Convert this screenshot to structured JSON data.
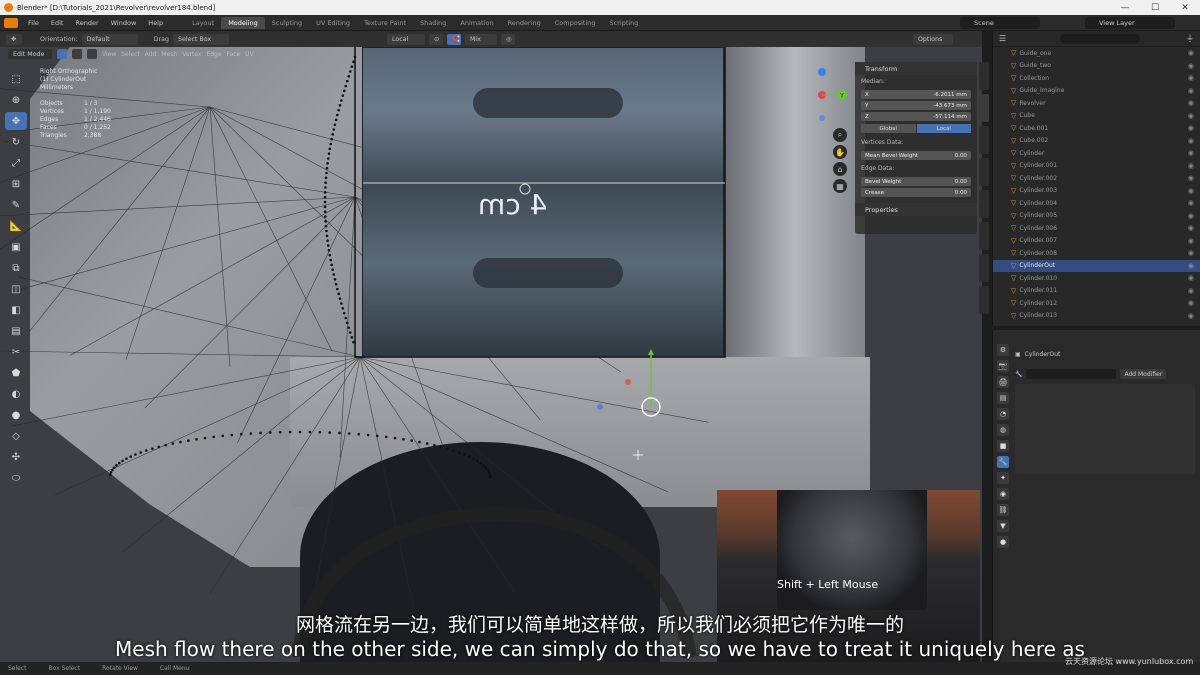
{
  "window": {
    "title": "Blender* [D:\\Tutorials_2021\\Revolver\\revolver184.blend]",
    "controls": [
      "—",
      "☐",
      "✕"
    ]
  },
  "menu": [
    "File",
    "Edit",
    "Render",
    "Window",
    "Help"
  ],
  "workspaces": [
    "Layout",
    "Modeling",
    "Sculpting",
    "UV Editing",
    "Texture Paint",
    "Shading",
    "Animation",
    "Rendering",
    "Compositing",
    "Scripting"
  ],
  "active_workspace": "Modeling",
  "scene": {
    "scene_label": "Scene",
    "view_layer_label": "View Layer"
  },
  "header2": {
    "orientation_label": "Orientation:",
    "orientation_value": "Default",
    "drag_label": "Drag",
    "drag_value": "Select Box",
    "pivot_value": "Local",
    "snap_value": "Mix",
    "options_label": "Options"
  },
  "header3": {
    "mode": "Edit Mode",
    "items": [
      "View",
      "Select",
      "Add",
      "Mesh",
      "Vertex",
      "Edge",
      "Face",
      "UV"
    ]
  },
  "viewport": {
    "view_name": "Right Orthographic",
    "object_name": "(1) CylinderOut",
    "units": "Millimeters",
    "stats": [
      {
        "label": "Objects",
        "value": "1 / 3"
      },
      {
        "label": "Vertices",
        "value": "1 / 1,190"
      },
      {
        "label": "Edges",
        "value": "1 / 2,446"
      },
      {
        "label": "Faces",
        "value": "0 / 1,252"
      },
      {
        "label": "Triangles",
        "value": "2,388"
      }
    ],
    "ref_text": "4 cm",
    "gizmo_axes": {
      "x": "X",
      "y": "Y",
      "z": "Z"
    },
    "colors": {
      "x": "#e8424f",
      "y": "#6bc33a",
      "z": "#3c7ef0"
    }
  },
  "tools": [
    "cursor",
    "move",
    "rotate",
    "scale",
    "transform",
    "annotate",
    "measure",
    "add-cube",
    "extrude",
    "inset",
    "bevel",
    "loop-cut",
    "knife",
    "poly-build",
    "spin",
    "smooth",
    "edge-slide",
    "shrink",
    "shear",
    "rip"
  ],
  "n_panel": {
    "title": "Transform",
    "median_label": "Median:",
    "fields": [
      {
        "axis": "X",
        "value": "-6.2011 mm"
      },
      {
        "axis": "Y",
        "value": "-43.673 mm"
      },
      {
        "axis": "Z",
        "value": "-57.114 mm"
      }
    ],
    "global_label": "Global",
    "local_label": "Local",
    "vertices_data_label": "Vertices Data:",
    "bevel_weight_label": "Mean Bevel Weight",
    "bevel_weight_value": "0.00",
    "edges_data_label": "Edge Data:",
    "edge_bevel_label": "Bevel Weight",
    "edge_bevel_value": "0.00",
    "crease_label": "Crease",
    "crease_value": "0.00",
    "properties_label": "Properties"
  },
  "cam_inset": {
    "shortcut": "Shift + Left Mouse"
  },
  "subtitles": {
    "cn": "网格流在另一边，我们可以简单地这样做，所以我们必须把它作为唯一的",
    "en": "Mesh flow there on the other side, we can simply do that, so we have to treat it uniquely here as"
  },
  "watermark": "云天资源论坛 www.yunlubox.com",
  "outliner": {
    "rows": [
      {
        "name": "Guide_one",
        "selected": false
      },
      {
        "name": "Guide_two",
        "selected": false
      },
      {
        "name": "Collection",
        "selected": false
      },
      {
        "name": "Guide_Imagine",
        "selected": false
      },
      {
        "name": "Revolver",
        "selected": false
      },
      {
        "name": "Cube",
        "selected": false
      },
      {
        "name": "Cube.001",
        "selected": false
      },
      {
        "name": "Cube.002",
        "selected": false
      },
      {
        "name": "Cylinder",
        "selected": false
      },
      {
        "name": "Cylinder.001",
        "selected": false
      },
      {
        "name": "Cylinder.002",
        "selected": false
      },
      {
        "name": "Cylinder.003",
        "selected": false
      },
      {
        "name": "Cylinder.004",
        "selected": false
      },
      {
        "name": "Cylinder.005",
        "selected": false
      },
      {
        "name": "Cylinder.006",
        "selected": false
      },
      {
        "name": "Cylinder.007",
        "selected": false
      },
      {
        "name": "Cylinder.008",
        "selected": false
      },
      {
        "name": "CylinderOut",
        "selected": true
      },
      {
        "name": "Cylinder.010",
        "selected": false
      },
      {
        "name": "Cylinder.011",
        "selected": false
      },
      {
        "name": "Cylinder.012",
        "selected": false
      },
      {
        "name": "Cylinder.013",
        "selected": false
      }
    ]
  },
  "properties": {
    "object_name": "CylinderOut",
    "add_modifier_label": "Add Modifier"
  },
  "statusbar": [
    "Select",
    "Box Select",
    "Rotate View",
    "Call Menu"
  ]
}
